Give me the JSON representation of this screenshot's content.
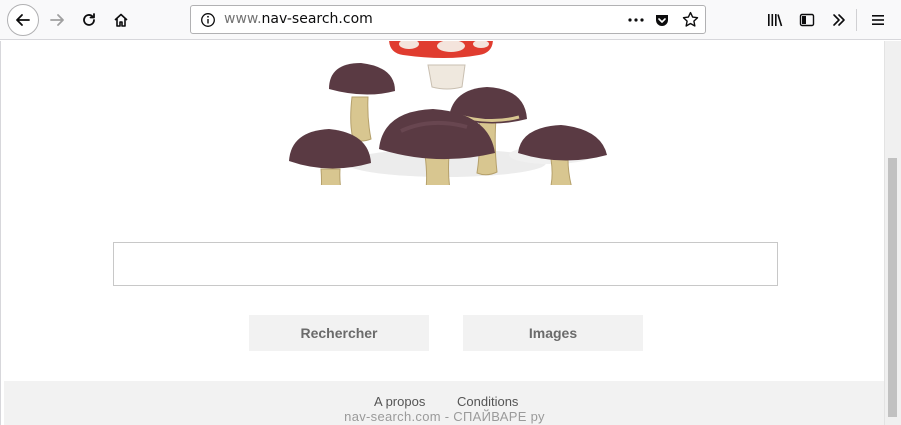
{
  "browser": {
    "url_prefix": "www.",
    "url_domain": "nav-search.com"
  },
  "search": {
    "placeholder": "",
    "search_label": "Rechercher",
    "images_label": "Images"
  },
  "footer": {
    "about": "A propos",
    "conditions": "Conditions"
  },
  "watermark": "nav-search.com - СПАЙВАРЕ ру",
  "colors": {
    "button_bg": "#f2f2f2",
    "footer_bg": "#f2f2f2",
    "mushroom_cap": "#5a3a43",
    "red_cap": "#e03c2f"
  }
}
